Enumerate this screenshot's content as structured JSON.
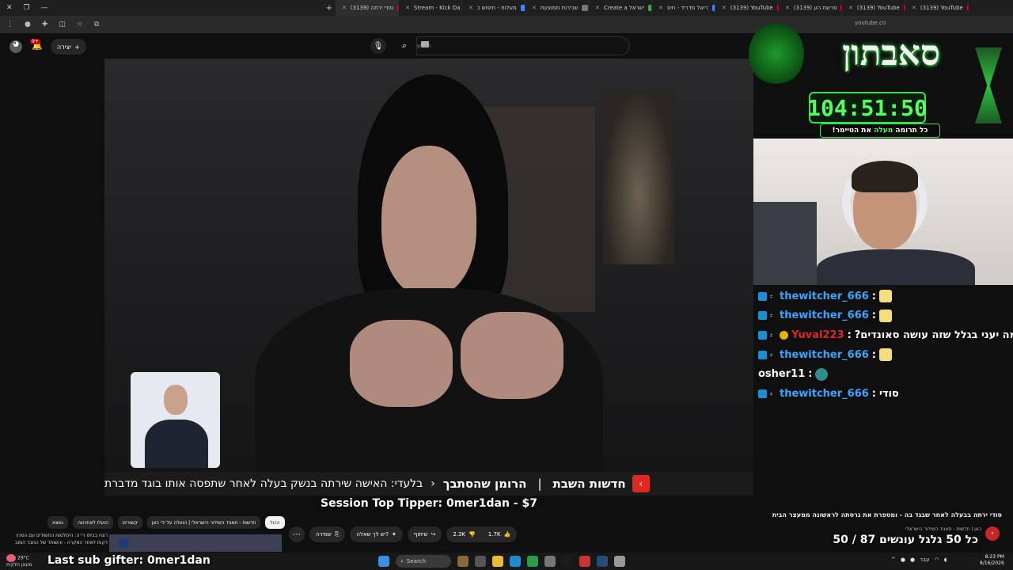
{
  "browser": {
    "tabs": [
      {
        "label": "(3139) סודי ירתה",
        "active": true,
        "color": "#ff0033"
      },
      {
        "label": "Stream - Kick Da",
        "active": false,
        "color": "#53fc18"
      },
      {
        "label": "מעלות - חיפוש כ",
        "active": false,
        "color": "#4285f4"
      },
      {
        "label": "שכירות ממוצעת",
        "active": false,
        "color": "#777777"
      },
      {
        "label": "Create a ישראל",
        "active": false,
        "color": "#34a853"
      },
      {
        "label": "ריאל מדריד - חיפ",
        "active": false,
        "color": "#4285f4"
      },
      {
        "label": "(3139) YouTube",
        "active": false,
        "color": "#ff0033"
      },
      {
        "label": "(3139) פרשת הע",
        "active": false,
        "color": "#ff0033"
      },
      {
        "label": "(3139) YouTube",
        "active": false,
        "color": "#ff0033"
      },
      {
        "label": "(3139) YouTube",
        "active": false,
        "color": "#ff0033"
      }
    ],
    "url": "youtube.co"
  },
  "yt_header": {
    "create_label": "יצירה",
    "notif_count": "9+",
    "search_placeholder": "חיפוש"
  },
  "video": {
    "ticker_channel": "חדשות השבת",
    "ticker_show": "הרומן שהסתבך",
    "ticker_headline": "בלעדי: האישה שירתה בנשק בעלה לאחר שתפסה אותו בוגד מדברת",
    "top_tipper": "Session Top Tipper: 0mer1dan - $7"
  },
  "chips": [
    "נמצא",
    "הועלו לאחרונה",
    "קשורים",
    "חדשות - תאגיד השידור הישראלי | הועלה על ידי כאן",
    "הכול"
  ],
  "related": {
    "caption_line1": "רצח בביתו רי׳ה: הימלטות החשודים עם הסכין",
    "caption_line2": "דקות לאחר המקרה - והשוחד של החבר המוב"
  },
  "actions": {
    "likes": "1.7K",
    "dislikes": "2.3K",
    "share": "שיתוף",
    "ask": "יש לך שאלה?",
    "save": "שמירה"
  },
  "overlay": {
    "logo_title": "סאבתון",
    "timer": "104:51:50",
    "sub_before": "כל תרומה",
    "sub_em": "מעלה",
    "sub_after": "את הטיימר!"
  },
  "chat": [
    {
      "user": "thewitcher_666",
      "text": "",
      "color": "#3ba6ff",
      "emote": true
    },
    {
      "user": "thewitcher_666",
      "text": "",
      "color": "#3ba6ff",
      "emote": true
    },
    {
      "user": "Yuval223",
      "text": "למה יעני בגלל שזה עושה סאונדים?",
      "color": "#e0262b",
      "emote": false
    },
    {
      "user": "thewitcher_666",
      "text": "",
      "color": "#3ba6ff",
      "emote": true
    },
    {
      "user": "osher11",
      "text": "",
      "color": "#ffffff",
      "emote": true
    },
    {
      "user": "thewitcher_666",
      "text": "סודי",
      "color": "#3ba6ff",
      "emote": false
    }
  ],
  "description": {
    "title": "סודי ירתה בבעלה לאחר שבגד בה - ומספרת את גרסתה לראשונה ממעצר הבית",
    "channel": "כאן | חדשות - תאגיד השידור הישראלי"
  },
  "goal": "כל 50 גלגל עונשים 87 / 50",
  "subgift": "Last sub gifter: 0mer1dan",
  "taskbar": {
    "weather_temp": "29°C",
    "weather_desc": "מעונן חלקית",
    "search": "Search",
    "time": "8:23 PM",
    "date": "8/16/2026",
    "lang": "עבר"
  }
}
